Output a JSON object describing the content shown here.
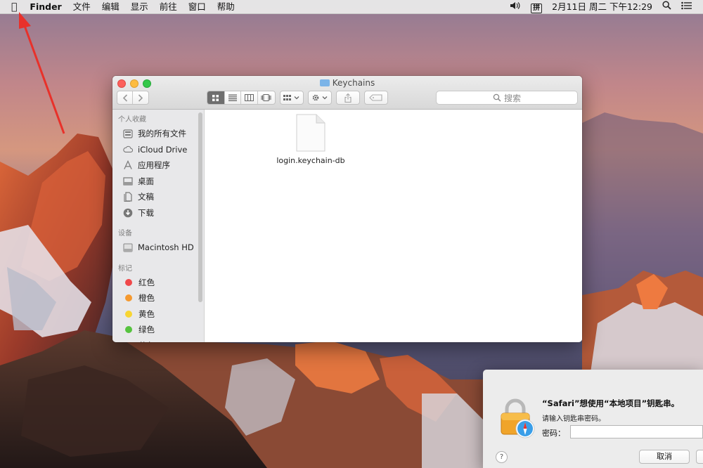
{
  "menubar": {
    "app_name": "Finder",
    "menus": [
      "文件",
      "编辑",
      "显示",
      "前往",
      "窗口",
      "帮助"
    ],
    "ime": "拼",
    "clock": "2月11日 周二 下午12:29"
  },
  "finder": {
    "title": "Keychains",
    "search_placeholder": "搜索",
    "sidebar": {
      "favorites_header": "个人收藏",
      "favorites": [
        {
          "label": "我的所有文件",
          "icon": "all-files-icon"
        },
        {
          "label": "iCloud Drive",
          "icon": "cloud-icon"
        },
        {
          "label": "应用程序",
          "icon": "applications-icon"
        },
        {
          "label": "桌面",
          "icon": "desktop-icon"
        },
        {
          "label": "文稿",
          "icon": "documents-icon"
        },
        {
          "label": "下载",
          "icon": "downloads-icon"
        }
      ],
      "devices_header": "设备",
      "devices": [
        {
          "label": "Macintosh HD",
          "icon": "hard-drive-icon"
        }
      ],
      "tags_header": "标记",
      "tags": [
        {
          "label": "红色",
          "color": "#f0484a"
        },
        {
          "label": "橙色",
          "color": "#f5992f"
        },
        {
          "label": "黄色",
          "color": "#f8d532"
        },
        {
          "label": "绿色",
          "color": "#56c33f"
        },
        {
          "label": "蓝色",
          "color": "#3b8ff0"
        }
      ]
    },
    "files": [
      {
        "name": "login.keychain-db",
        "icon": "document-icon"
      }
    ]
  },
  "dialog": {
    "title": "“Safari”想使用“本地项目”钥匙串。",
    "subtitle": "请输入钥匙串密码。",
    "password_label": "密码：",
    "password_value": "",
    "help": "?",
    "cancel_label": "取消"
  },
  "colors": {
    "annotation_arrow": "#e8312a",
    "view_mode_active": "#6e6e6e"
  }
}
